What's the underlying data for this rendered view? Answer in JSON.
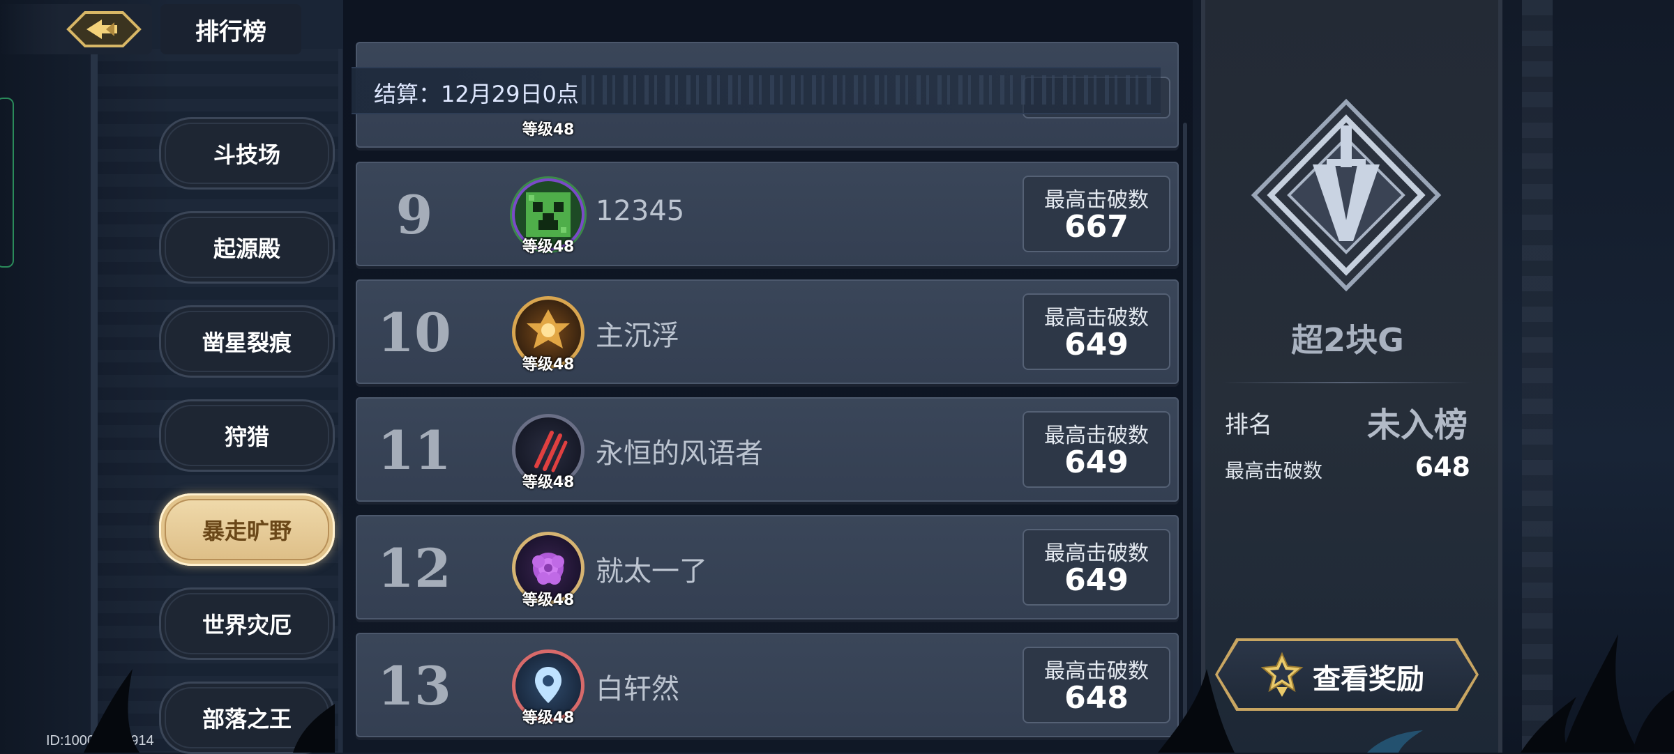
{
  "header": {
    "title": "排行榜"
  },
  "nav": [
    {
      "label": "斗技场",
      "active": false
    },
    {
      "label": "起源殿",
      "active": false
    },
    {
      "label": "凿星裂痕",
      "active": false
    },
    {
      "label": "狩猎",
      "active": false
    },
    {
      "label": "暴走旷野",
      "active": true
    },
    {
      "label": "世界灾厄",
      "active": false
    },
    {
      "label": "部落之王",
      "active": false
    }
  ],
  "settlement": "结算：12月29日0点",
  "score_label": "最高击破数",
  "rows": [
    {
      "rank": "9",
      "level": "等级48",
      "name": "12345",
      "score": "667",
      "avatar": "creeper-avatar-icon"
    },
    {
      "rank": "10",
      "level": "等级48",
      "name": "主沉浮",
      "score": "649",
      "avatar": "golden-crest-avatar-icon"
    },
    {
      "rank": "11",
      "level": "等级48",
      "name": "永恒的风语者",
      "score": "649",
      "avatar": "claw-avatar-icon"
    },
    {
      "rank": "12",
      "level": "等级48",
      "name": "就太一了",
      "score": "649",
      "avatar": "rose-avatar-icon"
    },
    {
      "rank": "13",
      "level": "等级48",
      "name": "白轩然",
      "score": "648",
      "avatar": "pin-avatar-icon"
    }
  ],
  "partial_row": {
    "level": "等级48"
  },
  "self": {
    "name": "超2块G",
    "rank_label": "排名",
    "rank_value": "未入榜",
    "score_label": "最高击破数",
    "score_value": "648",
    "emblem": "sword-diamond-emblem-icon"
  },
  "reward_button": "查看奖励",
  "footer": {
    "id": "ID:10005-992914"
  },
  "colors": {
    "active_tab": "#e8cf9a",
    "row_bg": "#384457",
    "accent_gold": "#c9a662"
  }
}
